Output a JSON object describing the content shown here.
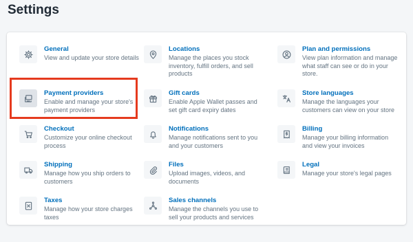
{
  "page": {
    "title": "Settings"
  },
  "items": [
    {
      "key": "general",
      "icon": "gear-icon",
      "title": "General",
      "desc": "View and update your store details"
    },
    {
      "key": "locations",
      "icon": "location-pin-icon",
      "title": "Locations",
      "desc": "Manage the places you stock inventory, fulfill orders, and sell products"
    },
    {
      "key": "plan",
      "icon": "user-circle-icon",
      "title": "Plan and permissions",
      "desc": "View plan information and manage what staff can see or do in your store."
    },
    {
      "key": "payment",
      "icon": "credit-card-icon",
      "title": "Payment providers",
      "desc": "Enable and manage your store's payment providers",
      "highlighted": true
    },
    {
      "key": "gift-cards",
      "icon": "gift-icon",
      "title": "Gift cards",
      "desc": "Enable Apple Wallet passes and set gift card expiry dates"
    },
    {
      "key": "languages",
      "icon": "translate-icon",
      "title": "Store languages",
      "desc": "Manage the languages your customers can view on your store"
    },
    {
      "key": "checkout",
      "icon": "cart-icon",
      "title": "Checkout",
      "desc": "Customize your online checkout process"
    },
    {
      "key": "notifications",
      "icon": "bell-icon",
      "title": "Notifications",
      "desc": "Manage notifications sent to you and your customers"
    },
    {
      "key": "billing",
      "icon": "billing-icon",
      "title": "Billing",
      "desc": "Manage your billing information and view your invoices"
    },
    {
      "key": "shipping",
      "icon": "truck-icon",
      "title": "Shipping",
      "desc": "Manage how you ship orders to customers"
    },
    {
      "key": "files",
      "icon": "paperclip-icon",
      "title": "Files",
      "desc": "Upload images, videos, and documents"
    },
    {
      "key": "legal",
      "icon": "legal-icon",
      "title": "Legal",
      "desc": "Manage your store's legal pages"
    },
    {
      "key": "taxes",
      "icon": "tax-icon",
      "title": "Taxes",
      "desc": "Manage how your store charges taxes"
    },
    {
      "key": "sales-channels",
      "icon": "sales-channels-icon",
      "title": "Sales channels",
      "desc": "Manage the channels you use to sell your products and services"
    }
  ]
}
